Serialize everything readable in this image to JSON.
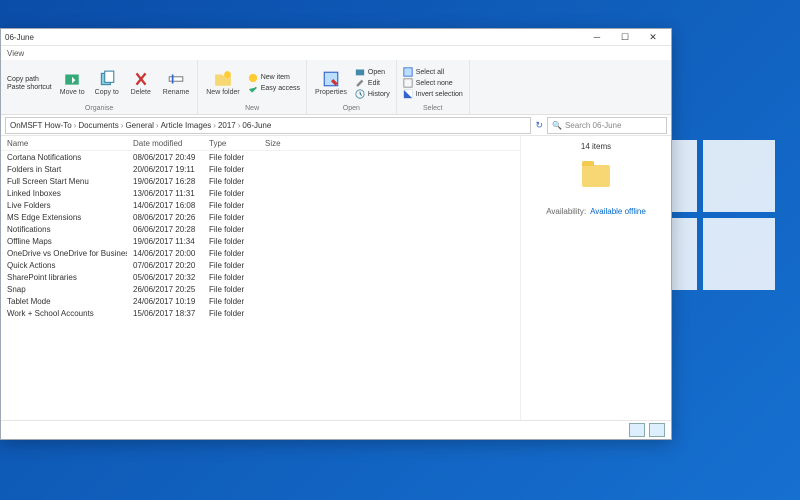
{
  "window": {
    "title": "06-June"
  },
  "ribbonTab": "View",
  "ribbon": {
    "clipboard": {
      "copyPath": "Copy path",
      "pasteShortcut": "Paste shortcut",
      "moveTo": "Move to",
      "copyTo": "Copy to",
      "delete": "Delete",
      "rename": "Rename",
      "group": "Organise"
    },
    "new": {
      "newFolder": "New folder",
      "newItem": "New item",
      "easyAccess": "Easy access",
      "group": "New"
    },
    "open": {
      "properties": "Properties",
      "open": "Open",
      "edit": "Edit",
      "history": "History",
      "group": "Open"
    },
    "select": {
      "selectAll": "Select all",
      "selectNone": "Select none",
      "invert": "Invert selection",
      "group": "Select"
    }
  },
  "breadcrumb": [
    "OnMSFT How-To",
    "Documents",
    "General",
    "Article Images",
    "2017",
    "06-June"
  ],
  "searchPlaceholder": "Search 06-June",
  "columns": {
    "name": "Name",
    "date": "Date modified",
    "type": "Type",
    "size": "Size"
  },
  "items": [
    {
      "name": "Cortana Notifications",
      "date": "08/06/2017 20:49",
      "type": "File folder"
    },
    {
      "name": "Folders in Start",
      "date": "20/06/2017 19:11",
      "type": "File folder"
    },
    {
      "name": "Full Screen Start Menu",
      "date": "19/06/2017 16:28",
      "type": "File folder"
    },
    {
      "name": "Linked Inboxes",
      "date": "13/06/2017 11:31",
      "type": "File folder"
    },
    {
      "name": "Live Folders",
      "date": "14/06/2017 16:08",
      "type": "File folder"
    },
    {
      "name": "MS Edge Extensions",
      "date": "08/06/2017 20:26",
      "type": "File folder"
    },
    {
      "name": "Notifications",
      "date": "06/06/2017 20:28",
      "type": "File folder"
    },
    {
      "name": "Offline Maps",
      "date": "19/06/2017 11:34",
      "type": "File folder"
    },
    {
      "name": "OneDrive vs OneDrive for Business",
      "date": "14/06/2017 20:00",
      "type": "File folder"
    },
    {
      "name": "Quick Actions",
      "date": "07/06/2017 20:20",
      "type": "File folder"
    },
    {
      "name": "SharePoint libraries",
      "date": "05/06/2017 20:32",
      "type": "File folder"
    },
    {
      "name": "Snap",
      "date": "26/06/2017 20:25",
      "type": "File folder"
    },
    {
      "name": "Tablet Mode",
      "date": "24/06/2017 10:19",
      "type": "File folder"
    },
    {
      "name": "Work + School Accounts",
      "date": "15/06/2017 18:37",
      "type": "File folder"
    }
  ],
  "preview": {
    "count": "14 items",
    "availabilityLabel": "Availability:",
    "availabilityValue": "Available offline"
  }
}
